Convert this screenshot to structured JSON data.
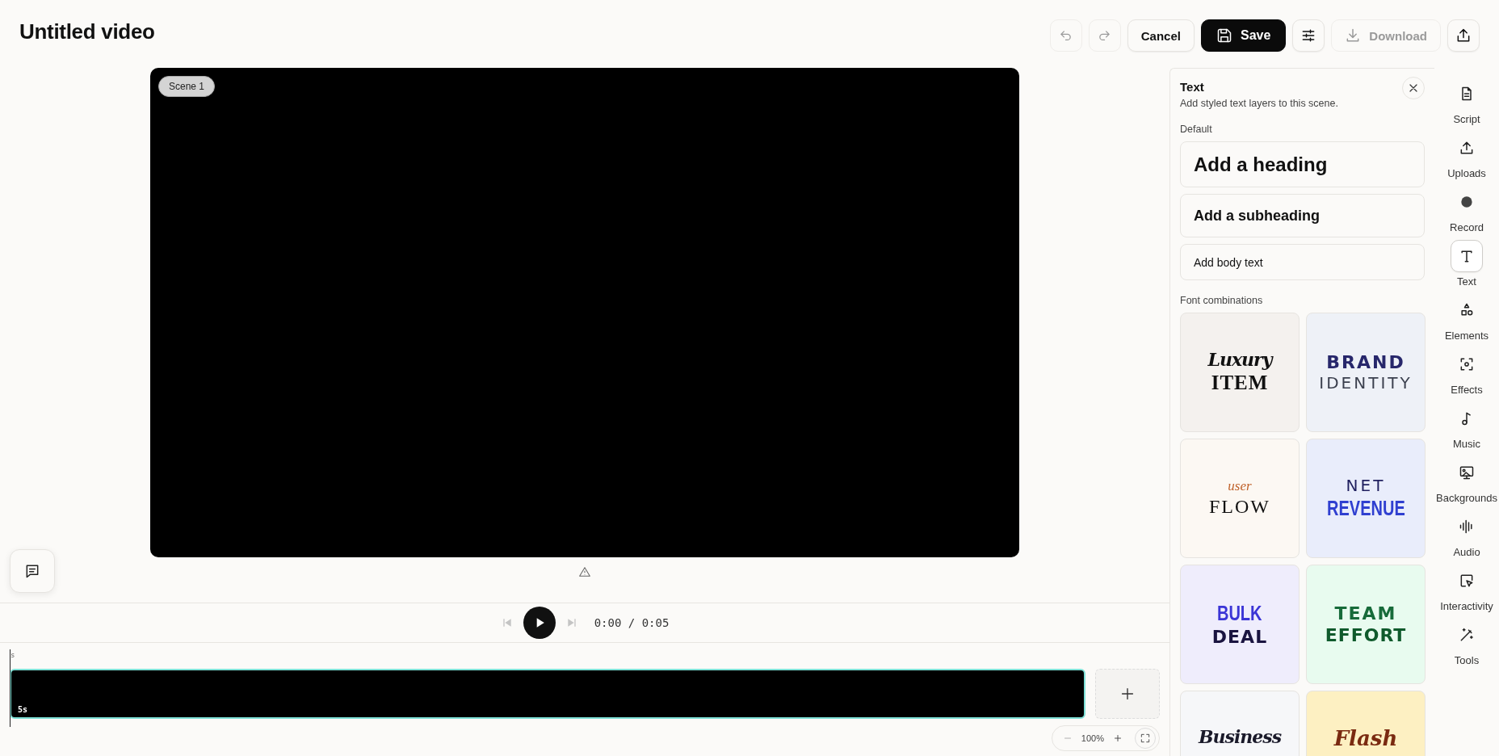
{
  "header": {
    "title": "Untitled video",
    "actions": [
      {
        "kind": "undo",
        "disabled": true
      },
      {
        "kind": "redo",
        "disabled": true
      },
      {
        "kind": "cancel",
        "label": "Cancel"
      },
      {
        "kind": "save",
        "label": "Save"
      },
      {
        "kind": "adjust"
      },
      {
        "kind": "download",
        "label": "Download",
        "disabled": true
      },
      {
        "kind": "share"
      }
    ]
  },
  "stage": {
    "scene_label": "Scene 1"
  },
  "player": {
    "time": "0:00 / 0:05"
  },
  "timeline": {
    "ruler_label": "s",
    "clip_label": "5s",
    "zoom": "100%"
  },
  "panel": {
    "title": "Text",
    "subtitle": "Add styled text layers to this scene.",
    "default_heading": "Default",
    "presets": [
      {
        "kind": "heading",
        "label": "Add a heading"
      },
      {
        "kind": "subheading",
        "label": "Add a subheading"
      },
      {
        "kind": "body",
        "label": "Add body text"
      }
    ],
    "combos_heading": "Font combinations",
    "combos": [
      {
        "color": "#f4f1ee",
        "lines": [
          {
            "text": "Luxury",
            "kind": "script",
            "color": "#111111"
          },
          {
            "text": "ITEM",
            "kind": "serif",
            "color": "#111111"
          }
        ]
      },
      {
        "color": "#eef1f7",
        "lines": [
          {
            "text": "BRAND",
            "kind": "wide",
            "color": "#27276b"
          },
          {
            "text": "IDENTITY",
            "kind": "light",
            "color": "#3a3f4d"
          }
        ]
      },
      {
        "color": "#fcf8f3",
        "lines": [
          {
            "text": "user",
            "kind": "hand",
            "color": "#c0622b"
          },
          {
            "text": "FLOW",
            "kind": "roman",
            "color": "#111111"
          }
        ]
      },
      {
        "color": "#e9edfb",
        "lines": [
          {
            "text": "NET",
            "kind": "light",
            "color": "#1f1f5e"
          },
          {
            "text": "REVENUE",
            "kind": "condensed",
            "color": "#2f3fd0"
          }
        ]
      },
      {
        "color": "#efedfc",
        "lines": [
          {
            "text": "BULK",
            "kind": "condensed",
            "color": "#3b35d6"
          },
          {
            "text": "DEAL",
            "kind": "black",
            "color": "#1a1440"
          }
        ]
      },
      {
        "color": "#e8fbef",
        "lines": [
          {
            "text": "TEAM",
            "kind": "wide",
            "color": "#176b3a"
          },
          {
            "text": "EFFORT",
            "kind": "black",
            "color": "#0f5a2c"
          }
        ]
      },
      {
        "color": "#f6f7f9",
        "lines": [
          {
            "text": "Business",
            "kind": "script",
            "color": "#1a1a2a"
          }
        ]
      },
      {
        "color": "#fdf0c2",
        "lines": [
          {
            "text": "Flash",
            "kind": "display",
            "color": "#7a2a10"
          }
        ]
      }
    ]
  },
  "rail": [
    {
      "label": "Script",
      "selected": false
    },
    {
      "label": "Uploads",
      "selected": false
    },
    {
      "label": "Record",
      "selected": false
    },
    {
      "label": "Text",
      "selected": true
    },
    {
      "label": "Elements",
      "selected": false
    },
    {
      "label": "Effects",
      "selected": false
    },
    {
      "label": "Music",
      "selected": false
    },
    {
      "label": "Backgrounds",
      "selected": false
    },
    {
      "label": "Audio",
      "selected": false
    },
    {
      "label": "Interactivity",
      "selected": false
    },
    {
      "label": "Tools",
      "selected": false
    }
  ]
}
